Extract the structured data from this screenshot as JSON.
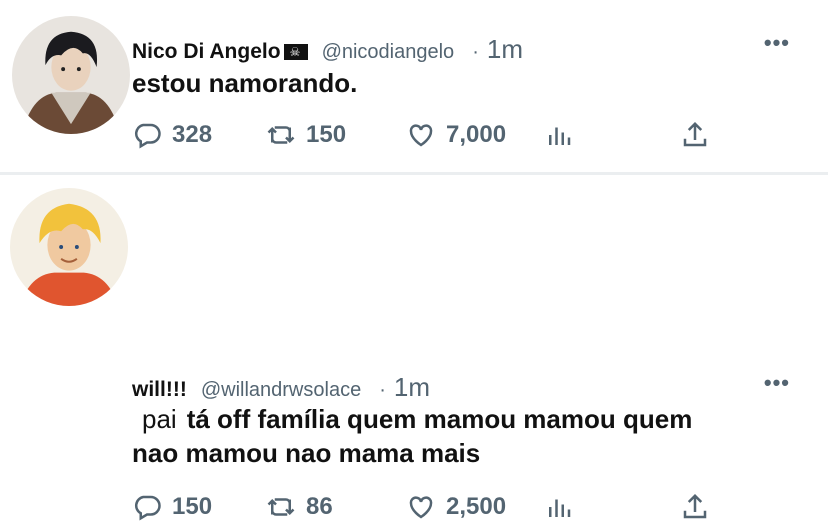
{
  "tweets": [
    {
      "name": "Nico Di Angelo",
      "handle": "@nicodiangelo",
      "separator": "·",
      "time": "1m",
      "text": "estou namorando.",
      "replies": "328",
      "retweets": "150",
      "likes": "7,000"
    },
    {
      "name": "will!!!",
      "handle": "@willandrwsolace",
      "separator": "·",
      "time": "1m",
      "text_prefix": "pai",
      "text_line1": "tá off família quem mamou mamou quem",
      "text_line2": "nao mamou nao mama mais",
      "replies": "150",
      "retweets": "86",
      "likes": "2,500"
    }
  ],
  "more_label": "•••",
  "icons": [
    "reply-icon",
    "retweet-icon",
    "like-icon",
    "analytics-icon",
    "share-icon",
    "flag-icon"
  ],
  "colors": {
    "text": "#0f1419",
    "secondary": "#536471",
    "divider": "#ebeef0"
  }
}
